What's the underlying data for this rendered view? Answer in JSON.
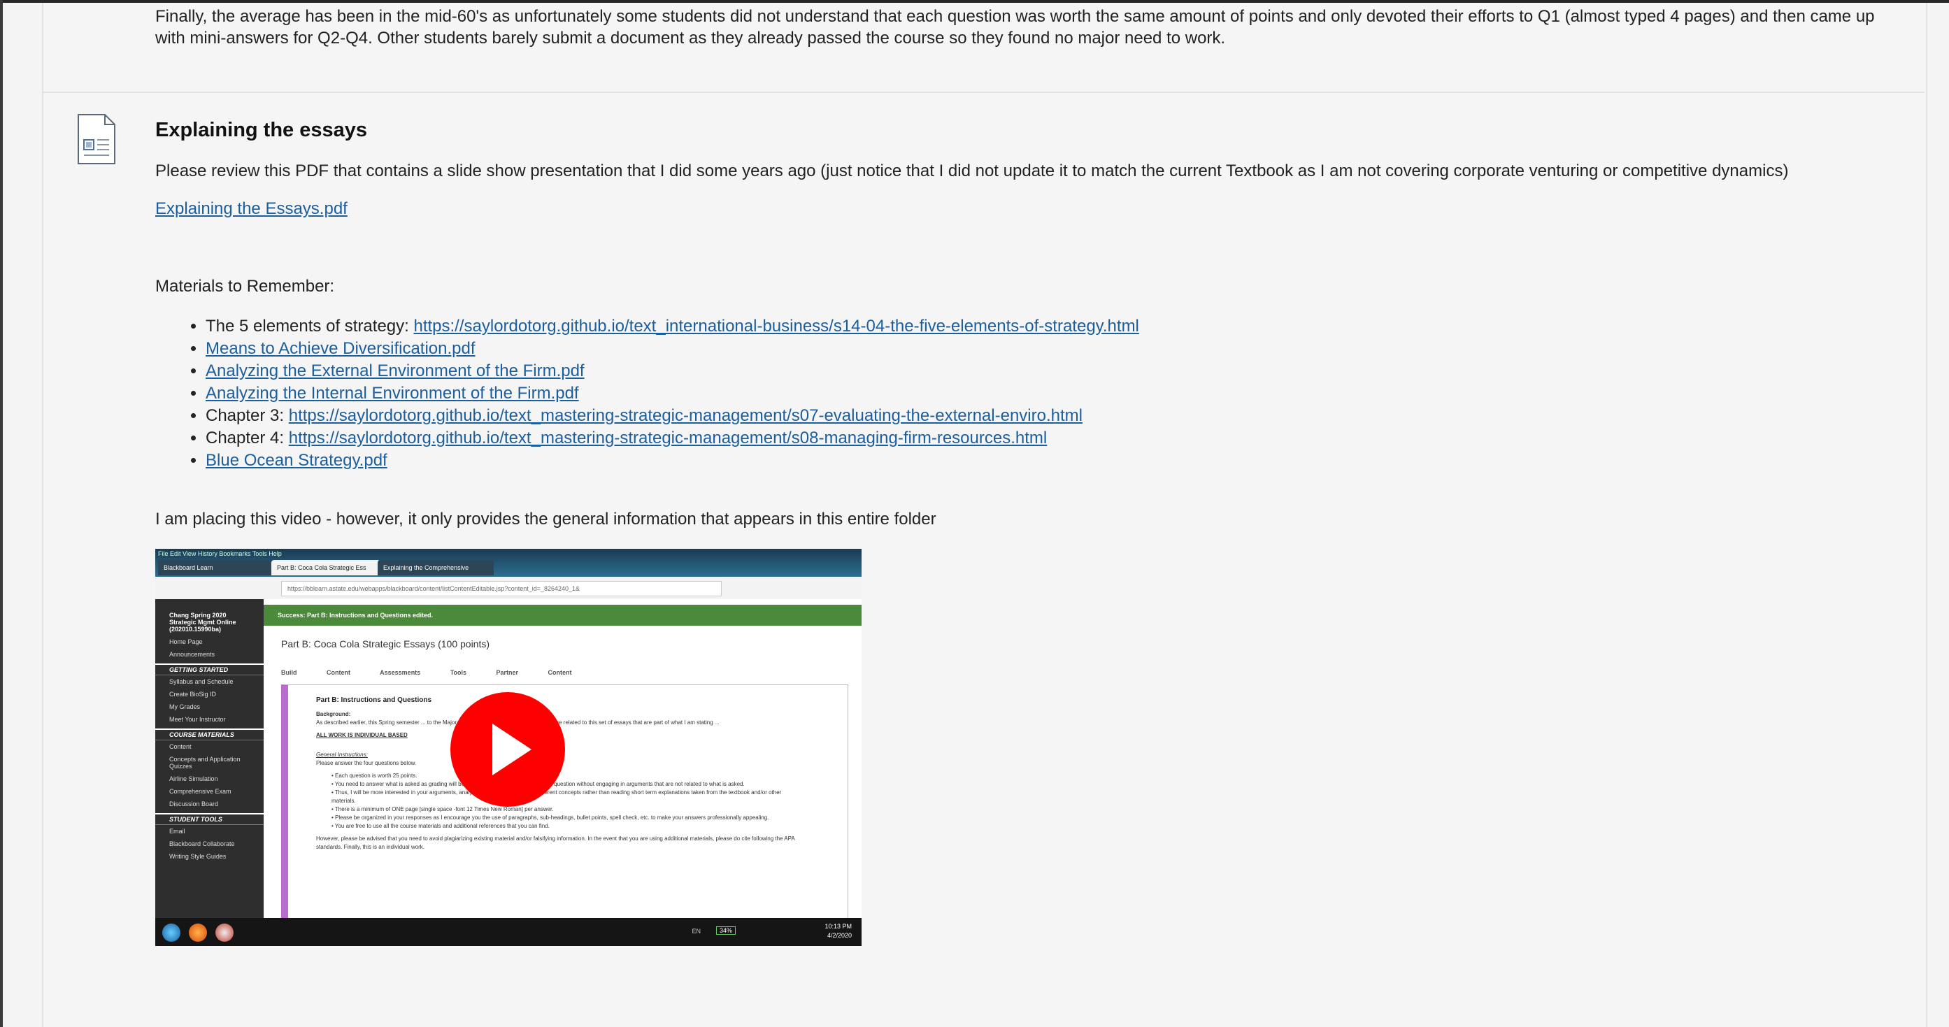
{
  "intro_text": "Finally, the average has been in the mid-60's as unfortunately some students did not understand that each question was worth the same amount of points and only devoted their efforts to Q1 (almost typed 4 pages) and then came up with mini-answers for Q2-Q4.  Other students barely submit a document as they already passed the course so they found no major need to work.",
  "item": {
    "icon": "document-icon",
    "title": "Explaining the essays",
    "description": "Please review this PDF that contains a slide show presentation that I did some years ago (just notice that I did not update it to match the current Textbook as I am not covering corporate venturing or competitive dynamics)",
    "pdf_link": "Explaining the  Essays.pdf",
    "materials_heading": "Materials to Remember:",
    "materials": [
      {
        "prefix": "The 5 elements of strategy: ",
        "link": "https://saylordotorg.github.io/text_international-business/s14-04-the-five-elements-of-strategy.html"
      },
      {
        "prefix": "",
        "link": "Means to Achieve Diversification.pdf"
      },
      {
        "prefix": "",
        "link": "Analyzing the External Environment of the Firm.pdf"
      },
      {
        "prefix": "",
        "link": "Analyzing the Internal Environment of the Firm.pdf"
      },
      {
        "prefix": "Chapter 3:  ",
        "link": "https://saylordotorg.github.io/text_mastering-strategic-management/s07-evaluating-the-external-enviro.html"
      },
      {
        "prefix": "Chapter 4: ",
        "link": "https://saylordotorg.github.io/text_mastering-strategic-management/s08-managing-firm-resources.html"
      },
      {
        "prefix": "",
        "link": "Blue Ocean Strategy.pdf"
      }
    ],
    "video_note": "I am placing this video - however, it only provides the general information that appears in this entire folder"
  },
  "video": {
    "menu": "File  Edit  View  History  Bookmarks  Tools  Help",
    "tabs": [
      "Blackboard Learn",
      "Part B: Coca Cola Strategic Ess",
      "Explaining the Comprehensive"
    ],
    "url": "https://bblearn.astate.edu/webapps/blackboard/content/listContentEditable.jsp?content_id=_8264240_1&",
    "course": "Chang Spring 2020 Strategic Mgmt Online (202010.15990ba)",
    "side_items_1": [
      "Home Page",
      "Announcements"
    ],
    "section_1": "GETTING STARTED",
    "side_items_2": [
      "Syllabus and Schedule",
      "Create BioSig ID",
      "My Grades",
      "Meet Your Instructor"
    ],
    "section_2": "COURSE MATERIALS",
    "side_items_3": [
      "Content",
      "Concepts and Application Quizzes",
      "Airline Simulation",
      "Comprehensive Exam",
      "Discussion Board"
    ],
    "section_3": "STUDENT TOOLS",
    "side_items_4": [
      "Email",
      "Blackboard Collaborate",
      "Writing Style Guides"
    ],
    "success": "Success: Part B: Instructions and Questions edited.",
    "page_title": "Part B: Coca Cola Strategic Essays (100 points)",
    "toolbar": "Build Content  Assessments  Tools  Partner Content",
    "content_title": "Part B: Instructions and Questions",
    "content_lines": [
      "Background:",
      "As described earlier, this Spring semester ... to the Major Field Test so the remaining 100 points are related to this set of essays that are part of what I am stating ...",
      "ALL WORK IS INDIVIDUAL BASED",
      "General Instructions:",
      "Please answer the four questions below.",
      "• Each question is worth 25 points.",
      "• You need to answer what is asked as grading will be based on your ability to answer the question without engaging in arguments that are not related to what is asked.",
      "• Thus, I will be more interested in your arguments, analysis, and application of the different concepts rather than reading short term explanations taken from the textbook and/or other materials.",
      "• There is a minimum of ONE page [single space -font 12 Times New Roman] per answer.",
      "• Please be organized in your responses as I encourage you the use of paragraphs, sub-headings, bullet points, spell check, etc. to make your answers professionally appealing.",
      "• You are free to use all the course materials and additional references that you can find.",
      "However, please be advised that you need to avoid plagiarizing existing material and/or falsifying information. In the event that you are using additional materials, please do cite following the APA standards. Finally, this is an individual work."
    ],
    "clock_time": "10:13 PM",
    "clock_date": "4/2/2020",
    "battery": "34%",
    "lang": "EN"
  }
}
